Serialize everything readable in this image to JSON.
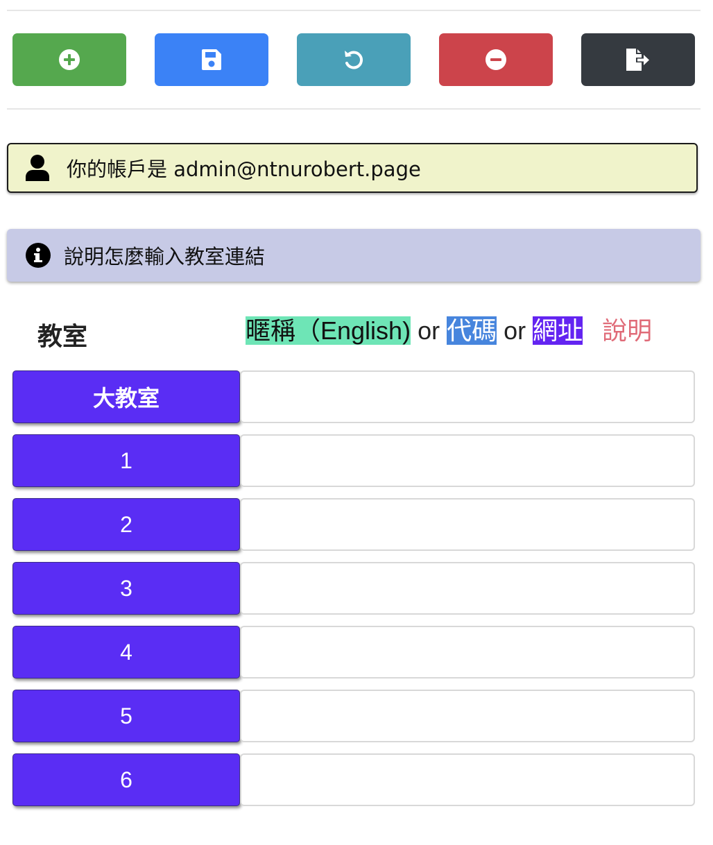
{
  "colors": {
    "add": "#55a84e",
    "save": "#3b82f6",
    "reset": "#4aa0b8",
    "remove": "#cc444b",
    "exit": "#353a40",
    "account_bg": "#f0f3cb",
    "help_bg": "#c7cae6",
    "room_button": "#5a2df4",
    "nickname_bg": "#6ee5b6",
    "code_bg": "#4785dd",
    "url_bg": "#6324f1",
    "help_link": "#e06b78"
  },
  "toolbar": {
    "buttons": [
      {
        "name": "add",
        "icon": "plus-circle-icon"
      },
      {
        "name": "save",
        "icon": "floppy-disk-icon"
      },
      {
        "name": "reset",
        "icon": "undo-icon"
      },
      {
        "name": "remove",
        "icon": "minus-circle-icon"
      },
      {
        "name": "exit",
        "icon": "sign-out-file-icon"
      }
    ]
  },
  "account": {
    "icon": "user-icon",
    "text": "你的帳戶是 admin@ntnurobert.page"
  },
  "help_banner": {
    "icon": "info-circle-icon",
    "text": "說明怎麼輸入教室連結"
  },
  "classroom_header": {
    "title": "教室",
    "nickname": "暱稱（English)",
    "or1": "or",
    "code": "代碼",
    "or2": "or",
    "url": "網址",
    "help_link": "說明"
  },
  "rooms": [
    {
      "label": "大教室",
      "value": ""
    },
    {
      "label": "1",
      "value": ""
    },
    {
      "label": "2",
      "value": ""
    },
    {
      "label": "3",
      "value": ""
    },
    {
      "label": "4",
      "value": ""
    },
    {
      "label": "5",
      "value": ""
    },
    {
      "label": "6",
      "value": ""
    }
  ]
}
